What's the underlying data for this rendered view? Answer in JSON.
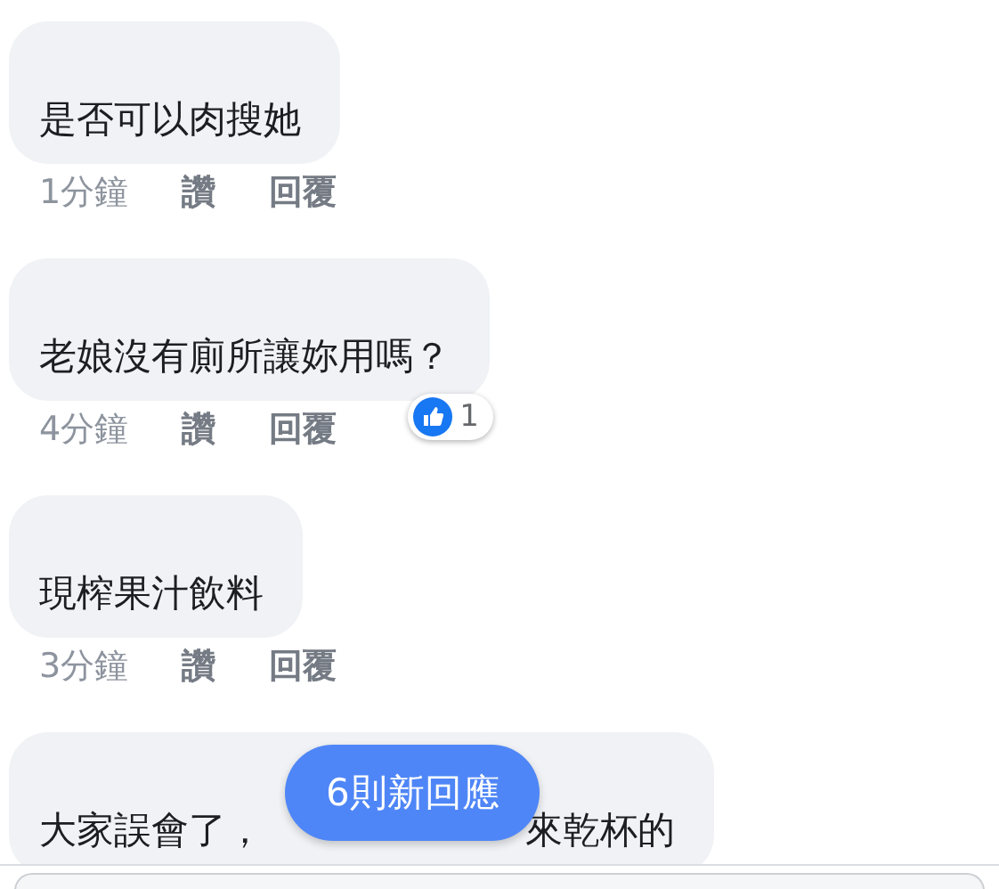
{
  "comments": [
    {
      "text": "是否可以肉搜她",
      "time": "1分鐘",
      "like": "讚",
      "reply": "回覆"
    },
    {
      "text": "老娘沒有廁所讓妳用嗎？",
      "time": "4分鐘",
      "like": "讚",
      "reply": "回覆",
      "reaction_count": "1"
    },
    {
      "text": "現榨果汁飲料",
      "time": "3分鐘",
      "like": "讚",
      "reply": "回覆"
    },
    {
      "text": "大家誤會了，",
      "text_end": "來乾杯的"
    }
  ],
  "new_replies_button": "6則新回應"
}
